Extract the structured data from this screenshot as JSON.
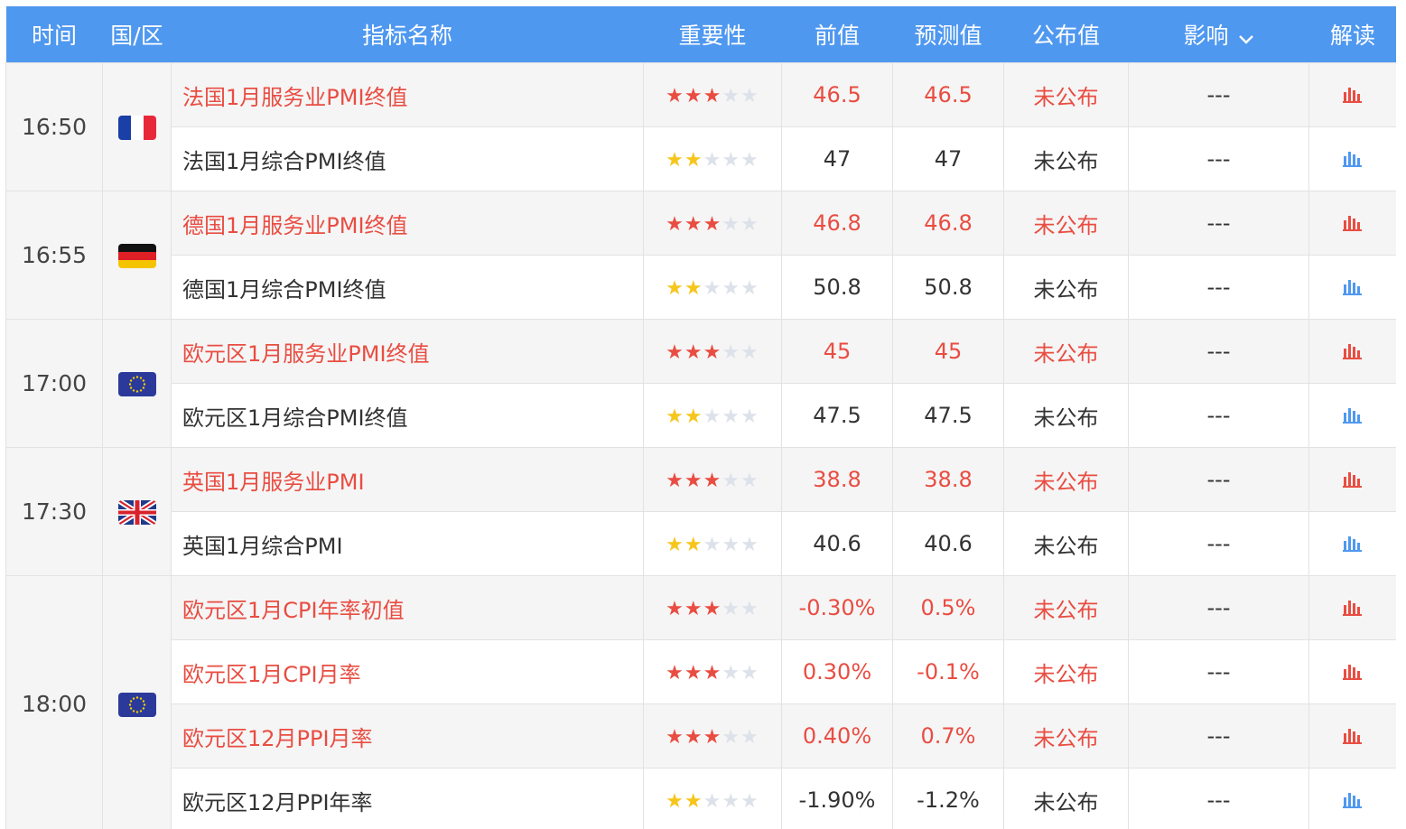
{
  "header": {
    "time": "时间",
    "region": "国/区",
    "indicator": "指标名称",
    "importance": "重要性",
    "previous": "前值",
    "forecast": "预测值",
    "actual": "公布值",
    "impact": "影响",
    "interpretation": "解读"
  },
  "colors": {
    "header_bg": "#4f98f0",
    "important_text": "#e94d42",
    "star_gold": "#f6c61d",
    "star_grey": "#dde2ea"
  },
  "groups": [
    {
      "time": "16:50",
      "flag": "france-flag",
      "rows": [
        {
          "name": "法国1月服务业PMI终值",
          "stars": 3,
          "previous": "46.5",
          "forecast": "46.5",
          "actual": "未公布",
          "impact": "---"
        },
        {
          "name": "法国1月综合PMI终值",
          "stars": 2,
          "previous": "47",
          "forecast": "47",
          "actual": "未公布",
          "impact": "---"
        }
      ]
    },
    {
      "time": "16:55",
      "flag": "germany-flag",
      "rows": [
        {
          "name": "德国1月服务业PMI终值",
          "stars": 3,
          "previous": "46.8",
          "forecast": "46.8",
          "actual": "未公布",
          "impact": "---"
        },
        {
          "name": "德国1月综合PMI终值",
          "stars": 2,
          "previous": "50.8",
          "forecast": "50.8",
          "actual": "未公布",
          "impact": "---"
        }
      ]
    },
    {
      "time": "17:00",
      "flag": "eu-flag",
      "rows": [
        {
          "name": "欧元区1月服务业PMI终值",
          "stars": 3,
          "previous": "45",
          "forecast": "45",
          "actual": "未公布",
          "impact": "---"
        },
        {
          "name": "欧元区1月综合PMI终值",
          "stars": 2,
          "previous": "47.5",
          "forecast": "47.5",
          "actual": "未公布",
          "impact": "---"
        }
      ]
    },
    {
      "time": "17:30",
      "flag": "uk-flag",
      "rows": [
        {
          "name": "英国1月服务业PMI",
          "stars": 3,
          "previous": "38.8",
          "forecast": "38.8",
          "actual": "未公布",
          "impact": "---"
        },
        {
          "name": "英国1月综合PMI",
          "stars": 2,
          "previous": "40.6",
          "forecast": "40.6",
          "actual": "未公布",
          "impact": "---"
        }
      ]
    },
    {
      "time": "18:00",
      "flag": "eu-flag",
      "rows": [
        {
          "name": "欧元区1月CPI年率初值",
          "stars": 3,
          "previous": "-0.30%",
          "forecast": "0.5%",
          "actual": "未公布",
          "impact": "---"
        },
        {
          "name": "欧元区1月CPI月率",
          "stars": 3,
          "previous": "0.30%",
          "forecast": "-0.1%",
          "actual": "未公布",
          "impact": "---"
        },
        {
          "name": "欧元区12月PPI月率",
          "stars": 3,
          "previous": "0.40%",
          "forecast": "0.7%",
          "actual": "未公布",
          "impact": "---"
        },
        {
          "name": "欧元区12月PPI年率",
          "stars": 2,
          "previous": "-1.90%",
          "forecast": "-1.2%",
          "actual": "未公布",
          "impact": "---"
        }
      ]
    }
  ]
}
